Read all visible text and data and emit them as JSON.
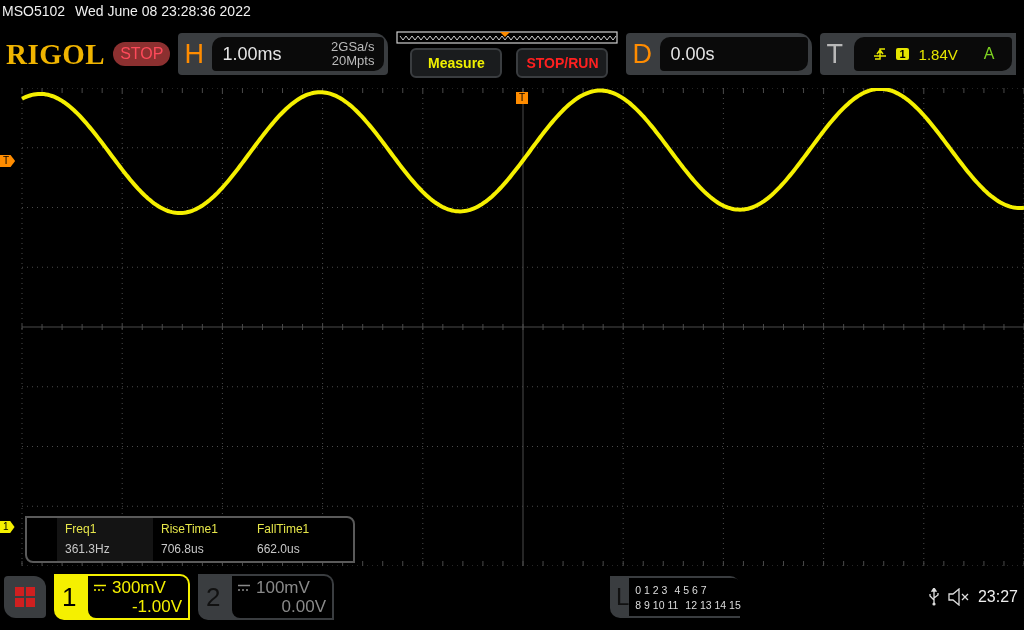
{
  "status_line": {
    "model": "MSO5102",
    "datetime": "Wed June 08 23:28:36 2022"
  },
  "header": {
    "logo": "RIGOL",
    "run_state": "STOP",
    "horizontal": {
      "label": "H",
      "timebase": "1.00ms",
      "sample_rate": "2GSa/s",
      "memory_depth": "20Mpts"
    },
    "buttons": [
      {
        "label": "Measure",
        "kind": "measure"
      },
      {
        "label": "STOP/RUN",
        "kind": "stoprun"
      }
    ],
    "delay": {
      "label": "D",
      "value": "0.00s"
    },
    "trigger": {
      "label": "T",
      "source": "1",
      "level": "1.84V",
      "mode": "A"
    }
  },
  "display": {
    "trigger_level_marker": "T",
    "trigger_position_marker": "T",
    "channel_marker": "1"
  },
  "measurements": [
    {
      "name": "Freq1",
      "value": "361.3Hz",
      "selected": true
    },
    {
      "name": "RiseTime1",
      "value": "706.8us",
      "selected": false
    },
    {
      "name": "FallTime1",
      "value": "662.0us",
      "selected": false
    }
  ],
  "channels": [
    {
      "number": "1",
      "scale": "300mV",
      "offset": "-1.00V",
      "active": true
    },
    {
      "number": "2",
      "scale": "100mV",
      "offset": "0.00V",
      "active": false
    }
  ],
  "logic": {
    "label": "L",
    "rows": [
      [
        "0 1 2 3",
        "4 5 6 7"
      ],
      [
        "8 9 10 11",
        "12 13 14 15"
      ]
    ]
  },
  "clock": "23:27"
}
